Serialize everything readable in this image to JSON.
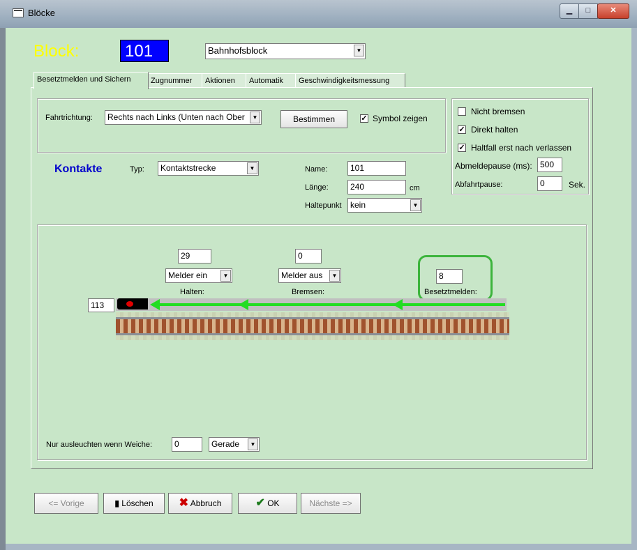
{
  "window": {
    "title": "Blöcke",
    "min_symbol": "▁",
    "max_symbol": "□",
    "close_symbol": "✕"
  },
  "header": {
    "block_label": "Block:",
    "block_number": "101",
    "block_type": "Bahnhofsblock"
  },
  "tabs": [
    {
      "label": "Besetztmelden und Sichern",
      "active": true
    },
    {
      "label": "Zugnummer"
    },
    {
      "label": "Aktionen"
    },
    {
      "label": "Automatik"
    },
    {
      "label": "Geschwindigkeitsmessung"
    }
  ],
  "direction": {
    "label": "Fahrtrichtung:",
    "value": "Rechts nach Links (Unten nach Ober",
    "determine_button": "Bestimmen",
    "show_symbol_label": "Symbol zeigen",
    "show_symbol_checked": true
  },
  "options": {
    "no_brake_label": "Nicht bremsen",
    "no_brake_checked": false,
    "direct_stop_label": "Direkt halten",
    "direct_stop_checked": true,
    "stop_after_leave_label": "Haltfall erst nach verlassen",
    "stop_after_leave_checked": true,
    "release_pause_label": "Abmeldepause (ms):",
    "release_pause_value": "500",
    "depart_pause_label": "Abfahrtpause:",
    "depart_pause_value": "0",
    "depart_pause_unit": "Sek."
  },
  "contacts": {
    "title": "Kontakte",
    "type_label": "Typ:",
    "type_value": "Kontaktstrecke",
    "name_label": "Name:",
    "name_value": "101",
    "length_label": "Länge:",
    "length_value": "240",
    "length_unit": "cm",
    "stop_point_label": "Haltepunkt",
    "stop_point_value": "kein"
  },
  "track": {
    "prev_block": "113",
    "halt": {
      "value": "29",
      "mode": "Melder ein",
      "label": "Halten:"
    },
    "brake": {
      "value": "0",
      "mode": "Melder aus",
      "label": "Bremsen:"
    },
    "occupied": {
      "value": "8",
      "label": "Besetztmelden:"
    }
  },
  "switch": {
    "label": "Nur ausleuchten wenn Weiche:",
    "value": "0",
    "position": "Gerade"
  },
  "footer": {
    "prev": "<= Vorige",
    "delete": "Löschen",
    "cancel": "Abbruch",
    "ok": "OK",
    "next": "Nächste =>"
  },
  "colors": {
    "client_bg": "#c8e6c8",
    "block_label": "#ffff00",
    "block_number_bg": "#0000ff",
    "arrow_green": "#22dd22",
    "highlight_green": "#3cb43c",
    "kontakte_blue": "#0000cc"
  }
}
